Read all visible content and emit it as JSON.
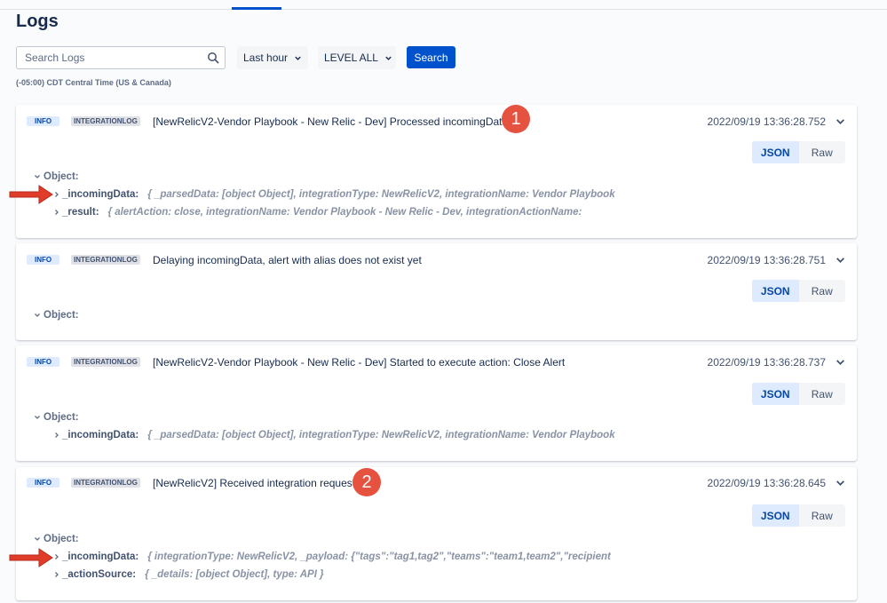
{
  "header": {
    "title": "Logs"
  },
  "search": {
    "placeholder": "Search Logs",
    "value": "",
    "button_label": "Search"
  },
  "filters": {
    "time_range": "Last hour",
    "level": "LEVEL ALL"
  },
  "timezone": "(-05:00) CDT Central Time (US & Canada)",
  "colors": {
    "primary": "#0052cc",
    "info_badge_bg": "#deebff",
    "annotation_red": "#e5523f"
  },
  "entries": [
    {
      "level": "INFO",
      "type": "INTEGRATIONLOG",
      "message": "[NewRelicV2-Vendor Playbook - New Relic - Dev] Processed incomingData",
      "timestamp": "2022/09/19 13:36:28.752",
      "toggle": {
        "json": "JSON",
        "raw": "Raw"
      },
      "object_label": "Object:",
      "properties": [
        {
          "key": "_incomingData:",
          "value": "{ _parsedData: [object Object], integrationType: NewRelicV2, integrationName: Vendor Playbook"
        },
        {
          "key": "_result:",
          "value": "{ alertAction: close, integrationName: Vendor Playbook - New Relic - Dev, integrationActionName:"
        }
      ],
      "annotation": "1"
    },
    {
      "level": "INFO",
      "type": "INTEGRATIONLOG",
      "message": "Delaying incomingData, alert with alias does not exist yet",
      "timestamp": "2022/09/19 13:36:28.751",
      "toggle": {
        "json": "JSON",
        "raw": "Raw"
      },
      "object_label": "Object:",
      "properties": []
    },
    {
      "level": "INFO",
      "type": "INTEGRATIONLOG",
      "message": "[NewRelicV2-Vendor Playbook - New Relic - Dev] Started to execute action: Close Alert",
      "timestamp": "2022/09/19 13:36:28.737",
      "toggle": {
        "json": "JSON",
        "raw": "Raw"
      },
      "object_label": "Object:",
      "properties": [
        {
          "key": "_incomingData:",
          "value": "{ _parsedData: [object Object], integrationType: NewRelicV2, integrationName: Vendor Playbook"
        }
      ]
    },
    {
      "level": "INFO",
      "type": "INTEGRATIONLOG",
      "message": "[NewRelicV2] Received integration request",
      "timestamp": "2022/09/19 13:36:28.645",
      "toggle": {
        "json": "JSON",
        "raw": "Raw"
      },
      "object_label": "Object:",
      "properties": [
        {
          "key": "_incomingData:",
          "value": "{ integrationType: NewRelicV2, _payload: {\"tags\":\"tag1,tag2\",\"teams\":\"team1,team2\",\"recipient"
        },
        {
          "key": "_actionSource:",
          "value": "{ _details: [object Object], type: API }"
        }
      ],
      "annotation": "2"
    }
  ]
}
